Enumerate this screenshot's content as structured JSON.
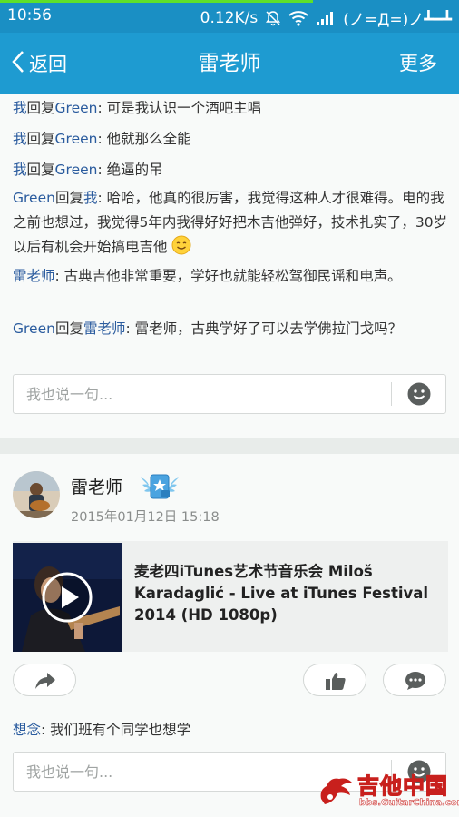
{
  "status_bar": {
    "time": "10:56",
    "net_speed": "0.12K/s",
    "status_text": "(ノ=Д=)ノ┻━┻",
    "colors": {
      "background": "#1a8fc4",
      "progress": "#5ee02a"
    },
    "icons": [
      "bell-muted-icon",
      "wifi-icon",
      "signal-icon"
    ]
  },
  "nav": {
    "back_label": "返回",
    "title": "雷老师",
    "more_label": "更多",
    "background": "#1e9bd1"
  },
  "thread": {
    "comments": [
      {
        "from": "我",
        "verb": "回复",
        "to": "Green",
        "sep": ": ",
        "text": "可是我认识一个酒吧主唱"
      },
      {
        "from": "我",
        "verb": "回复",
        "to": "Green",
        "sep": ": ",
        "text": "他就那么全能"
      },
      {
        "from": "我",
        "verb": "回复",
        "to": "Green",
        "sep": ": ",
        "text": "绝逼的吊"
      },
      {
        "from": "Green",
        "verb": "回复",
        "to": "我",
        "sep": ": ",
        "text": "哈哈，他真的很厉害，我觉得这种人才很难得。电的我之前也想过，我觉得5年内我得好好把木吉他弹好，技术扎实了，30岁以后有机会开始搞电吉他"
      },
      {
        "from": "雷老师",
        "sep": ": ",
        "text": "古典吉他非常重要，学好也就能轻松驾御民谣和电声。"
      },
      {
        "from": "Green",
        "verb": "回复",
        "to": "雷老师",
        "sep": ": ",
        "text": "雷老师，古典学好了可以去学佛拉门戈吗？"
      }
    ],
    "reply_placeholder": "我也说一句..."
  },
  "post": {
    "author": "雷老师",
    "date": "2015年01月12日 15:18",
    "badge_icon": "winged-badge-icon",
    "share_title": "麦老四iTunes艺术节音乐会 Miloš Karadaglić - Live at iTunes Festival 2014 (HD 1080p)",
    "comments": [
      {
        "from": "想念",
        "sep": ": ",
        "text": "我们班有个同学也想学"
      }
    ],
    "reply_placeholder": "我也说一句..."
  },
  "watermark": {
    "title": "吉他中国",
    "url": "bbs.GuitarChina.com"
  },
  "colors": {
    "link": "#2a5b9e",
    "page_bg": "#e8ecea",
    "card_bg": "#f8faf9"
  }
}
